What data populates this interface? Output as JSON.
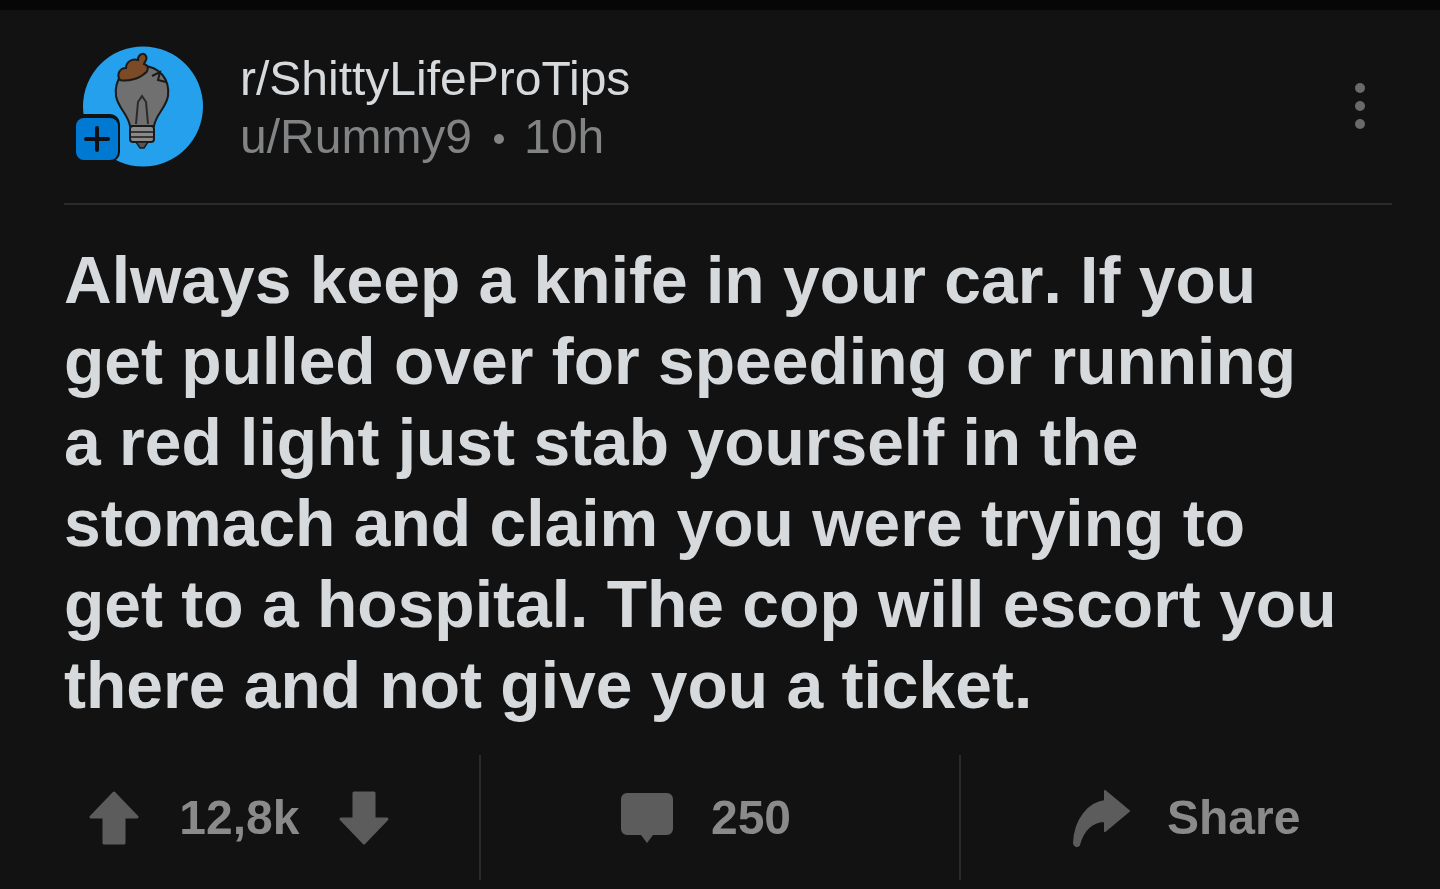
{
  "post": {
    "community": "r/ShittyLifeProTips",
    "author": "u/Rummy9",
    "age": "10h",
    "body": "Always keep a knife in your car. If you get pulled over for speeding or running a red light just stab yourself in the stomach and claim you were trying to get to a hospital. The cop will escort you there and not give you a ticket.",
    "actions": {
      "score": "12,8k",
      "comments": "250",
      "share": "Share"
    }
  }
}
